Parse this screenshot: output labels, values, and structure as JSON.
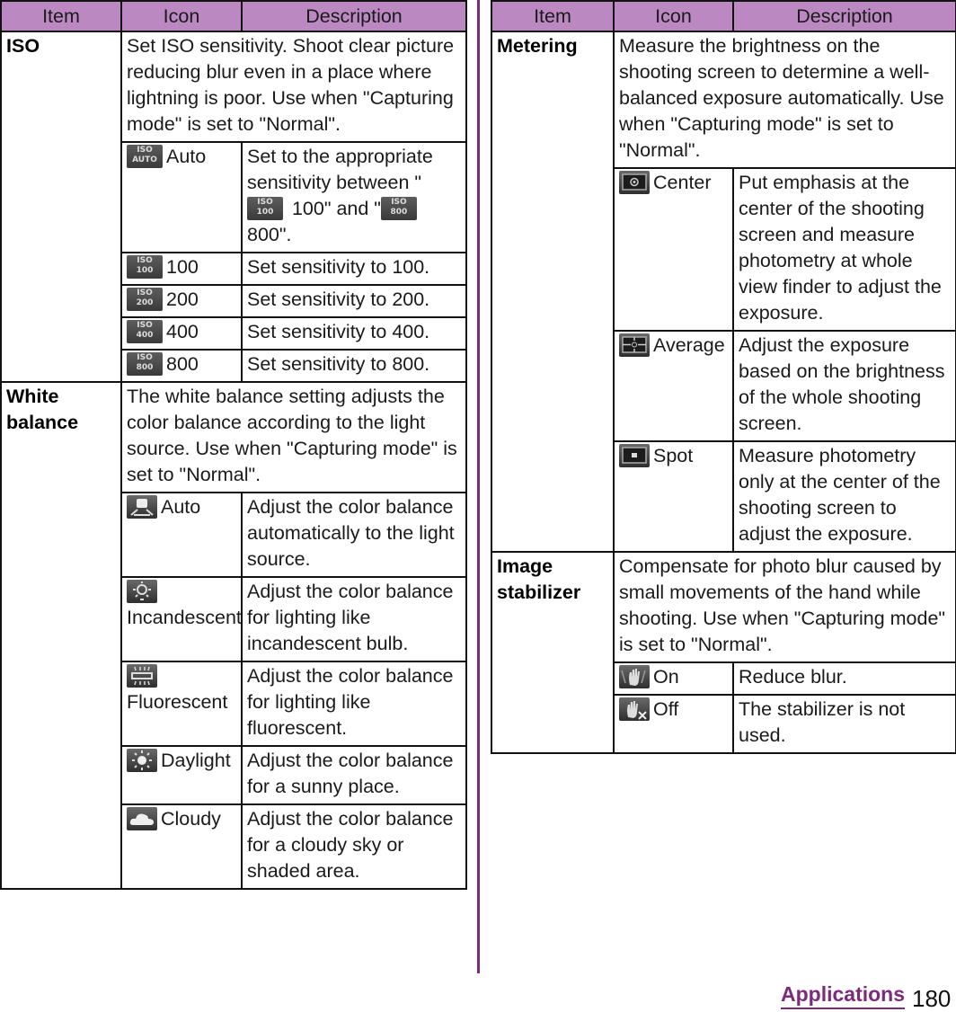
{
  "headers": {
    "item": "Item",
    "icon": "Icon",
    "description": "Description"
  },
  "left_table": {
    "iso": {
      "item": "ISO",
      "description": "Set ISO sensitivity. Shoot clear picture reducing blur even in a place where lightning is poor. Use when \"Capturing mode\" is set to \"Normal\".",
      "options": [
        {
          "icon": "iso-auto-icon",
          "icon_text": [
            "ISO",
            "AUTO"
          ],
          "label": "Auto",
          "desc_parts": [
            "Set to the appropriate sensitivity between \"",
            " 100\" and \"",
            " 800\"."
          ],
          "inline_icons": [
            [
              "ISO",
              "100"
            ],
            [
              "ISO",
              "800"
            ]
          ]
        },
        {
          "icon": "iso-100-icon",
          "icon_text": [
            "ISO",
            "100"
          ],
          "label": "100",
          "description": "Set sensitivity to 100."
        },
        {
          "icon": "iso-200-icon",
          "icon_text": [
            "ISO",
            "200"
          ],
          "label": "200",
          "description": "Set sensitivity to 200."
        },
        {
          "icon": "iso-400-icon",
          "icon_text": [
            "ISO",
            "400"
          ],
          "label": "400",
          "description": "Set sensitivity to 400."
        },
        {
          "icon": "iso-800-icon",
          "icon_text": [
            "ISO",
            "800"
          ],
          "label": "800",
          "description": "Set sensitivity to 800."
        }
      ]
    },
    "white_balance": {
      "item": "White balance",
      "description": "The white balance setting adjusts the color balance according to the light source. Use when \"Capturing mode\" is set to \"Normal\".",
      "options": [
        {
          "icon": "wb-auto-icon",
          "label": "Auto",
          "description": "Adjust the color balance automatically to the light source."
        },
        {
          "icon": "incandescent-bulb-icon",
          "label": "Incandescent",
          "description": "Adjust the color balance for lighting like incandescent bulb."
        },
        {
          "icon": "fluorescent-lamp-icon",
          "label": "Fluorescent",
          "description": "Adjust the color balance for lighting like fluorescent."
        },
        {
          "icon": "sun-icon",
          "label": "Daylight",
          "description": "Adjust the color balance for a sunny place."
        },
        {
          "icon": "cloud-icon",
          "label": "Cloudy",
          "description": "Adjust the color balance for a cloudy sky or shaded area."
        }
      ]
    }
  },
  "right_table": {
    "metering": {
      "item": "Metering",
      "description": "Measure the brightness on the shooting screen to determine a well-balanced exposure automatically. Use when \"Capturing mode\" is set to \"Normal\".",
      "options": [
        {
          "icon": "center-metering-icon",
          "label": "Center",
          "description": "Put emphasis at the center of the shooting screen and measure photometry at whole view finder to adjust the exposure."
        },
        {
          "icon": "average-metering-icon",
          "label": "Average",
          "description": "Adjust the exposure based on the brightness of the whole shooting screen."
        },
        {
          "icon": "spot-metering-icon",
          "label": "Spot",
          "description": "Measure photometry only at the center of the shooting screen to adjust the exposure."
        }
      ]
    },
    "image_stabilizer": {
      "item": "Image stabilizer",
      "description": "Compensate for photo blur caused by small movements of the hand while shooting. Use when \"Capturing mode\" is set to \"Normal\".",
      "options": [
        {
          "icon": "stabilizer-on-icon",
          "label": "On",
          "description": "Reduce blur."
        },
        {
          "icon": "stabilizer-off-icon",
          "label": "Off",
          "description": "The stabilizer is not used."
        }
      ]
    }
  },
  "footer": {
    "section": "Applications",
    "page_number": "180"
  },
  "colors": {
    "header_bg": "#bb88c2",
    "accent": "#7d2a7c"
  }
}
